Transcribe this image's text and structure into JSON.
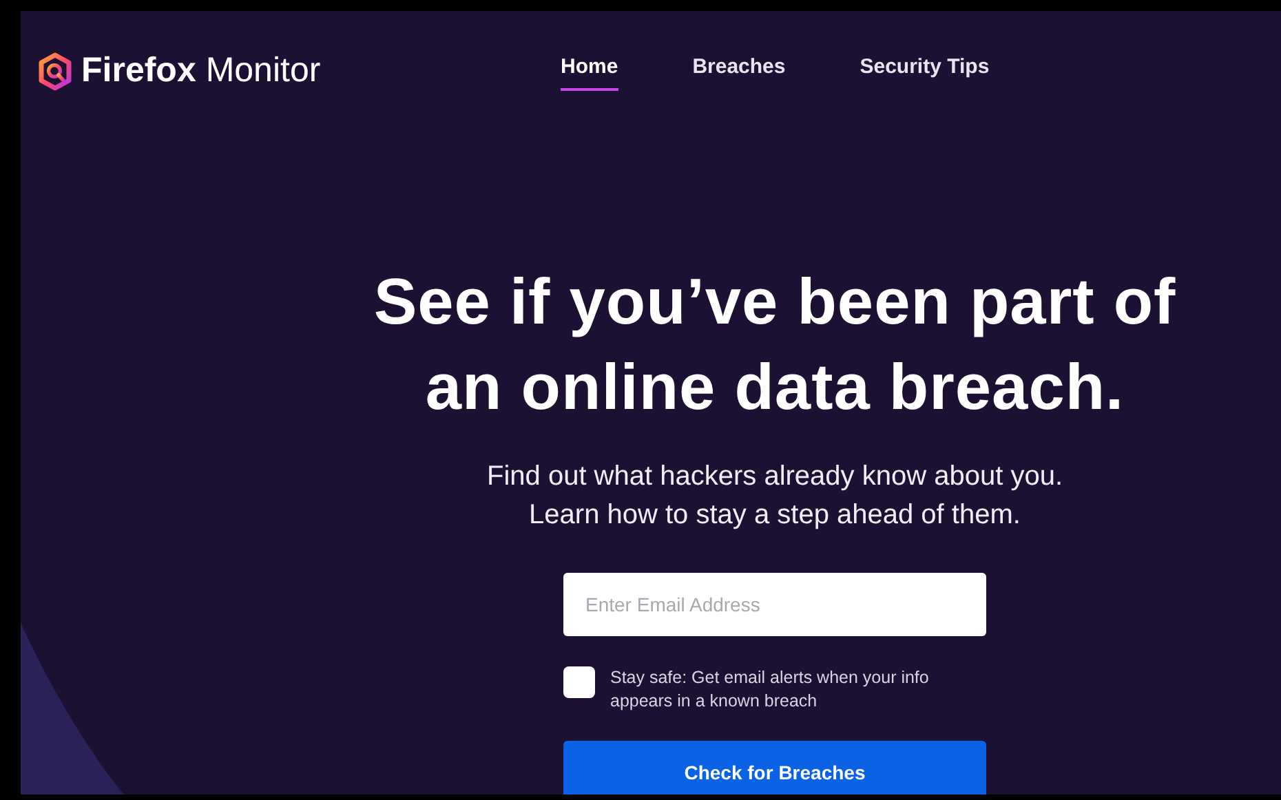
{
  "brand": {
    "name_bold": "Firefox",
    "name_light": "Monitor"
  },
  "nav": [
    {
      "label": "Home",
      "selected": true
    },
    {
      "label": "Breaches",
      "selected": false
    },
    {
      "label": "Security Tips",
      "selected": false
    }
  ],
  "hero": {
    "headline": [
      "See if you’ve been part of",
      "an online data breach."
    ],
    "subtitle": [
      "Find out what hackers already know about you.",
      "Learn how to stay a step ahead of them."
    ]
  },
  "form": {
    "email": {
      "placeholder": "Enter Email Address"
    },
    "alerts": {
      "label": "Stay safe: Get email alerts when your info appears in a known breach",
      "checked": false
    },
    "submit": "Check for Breaches"
  }
}
